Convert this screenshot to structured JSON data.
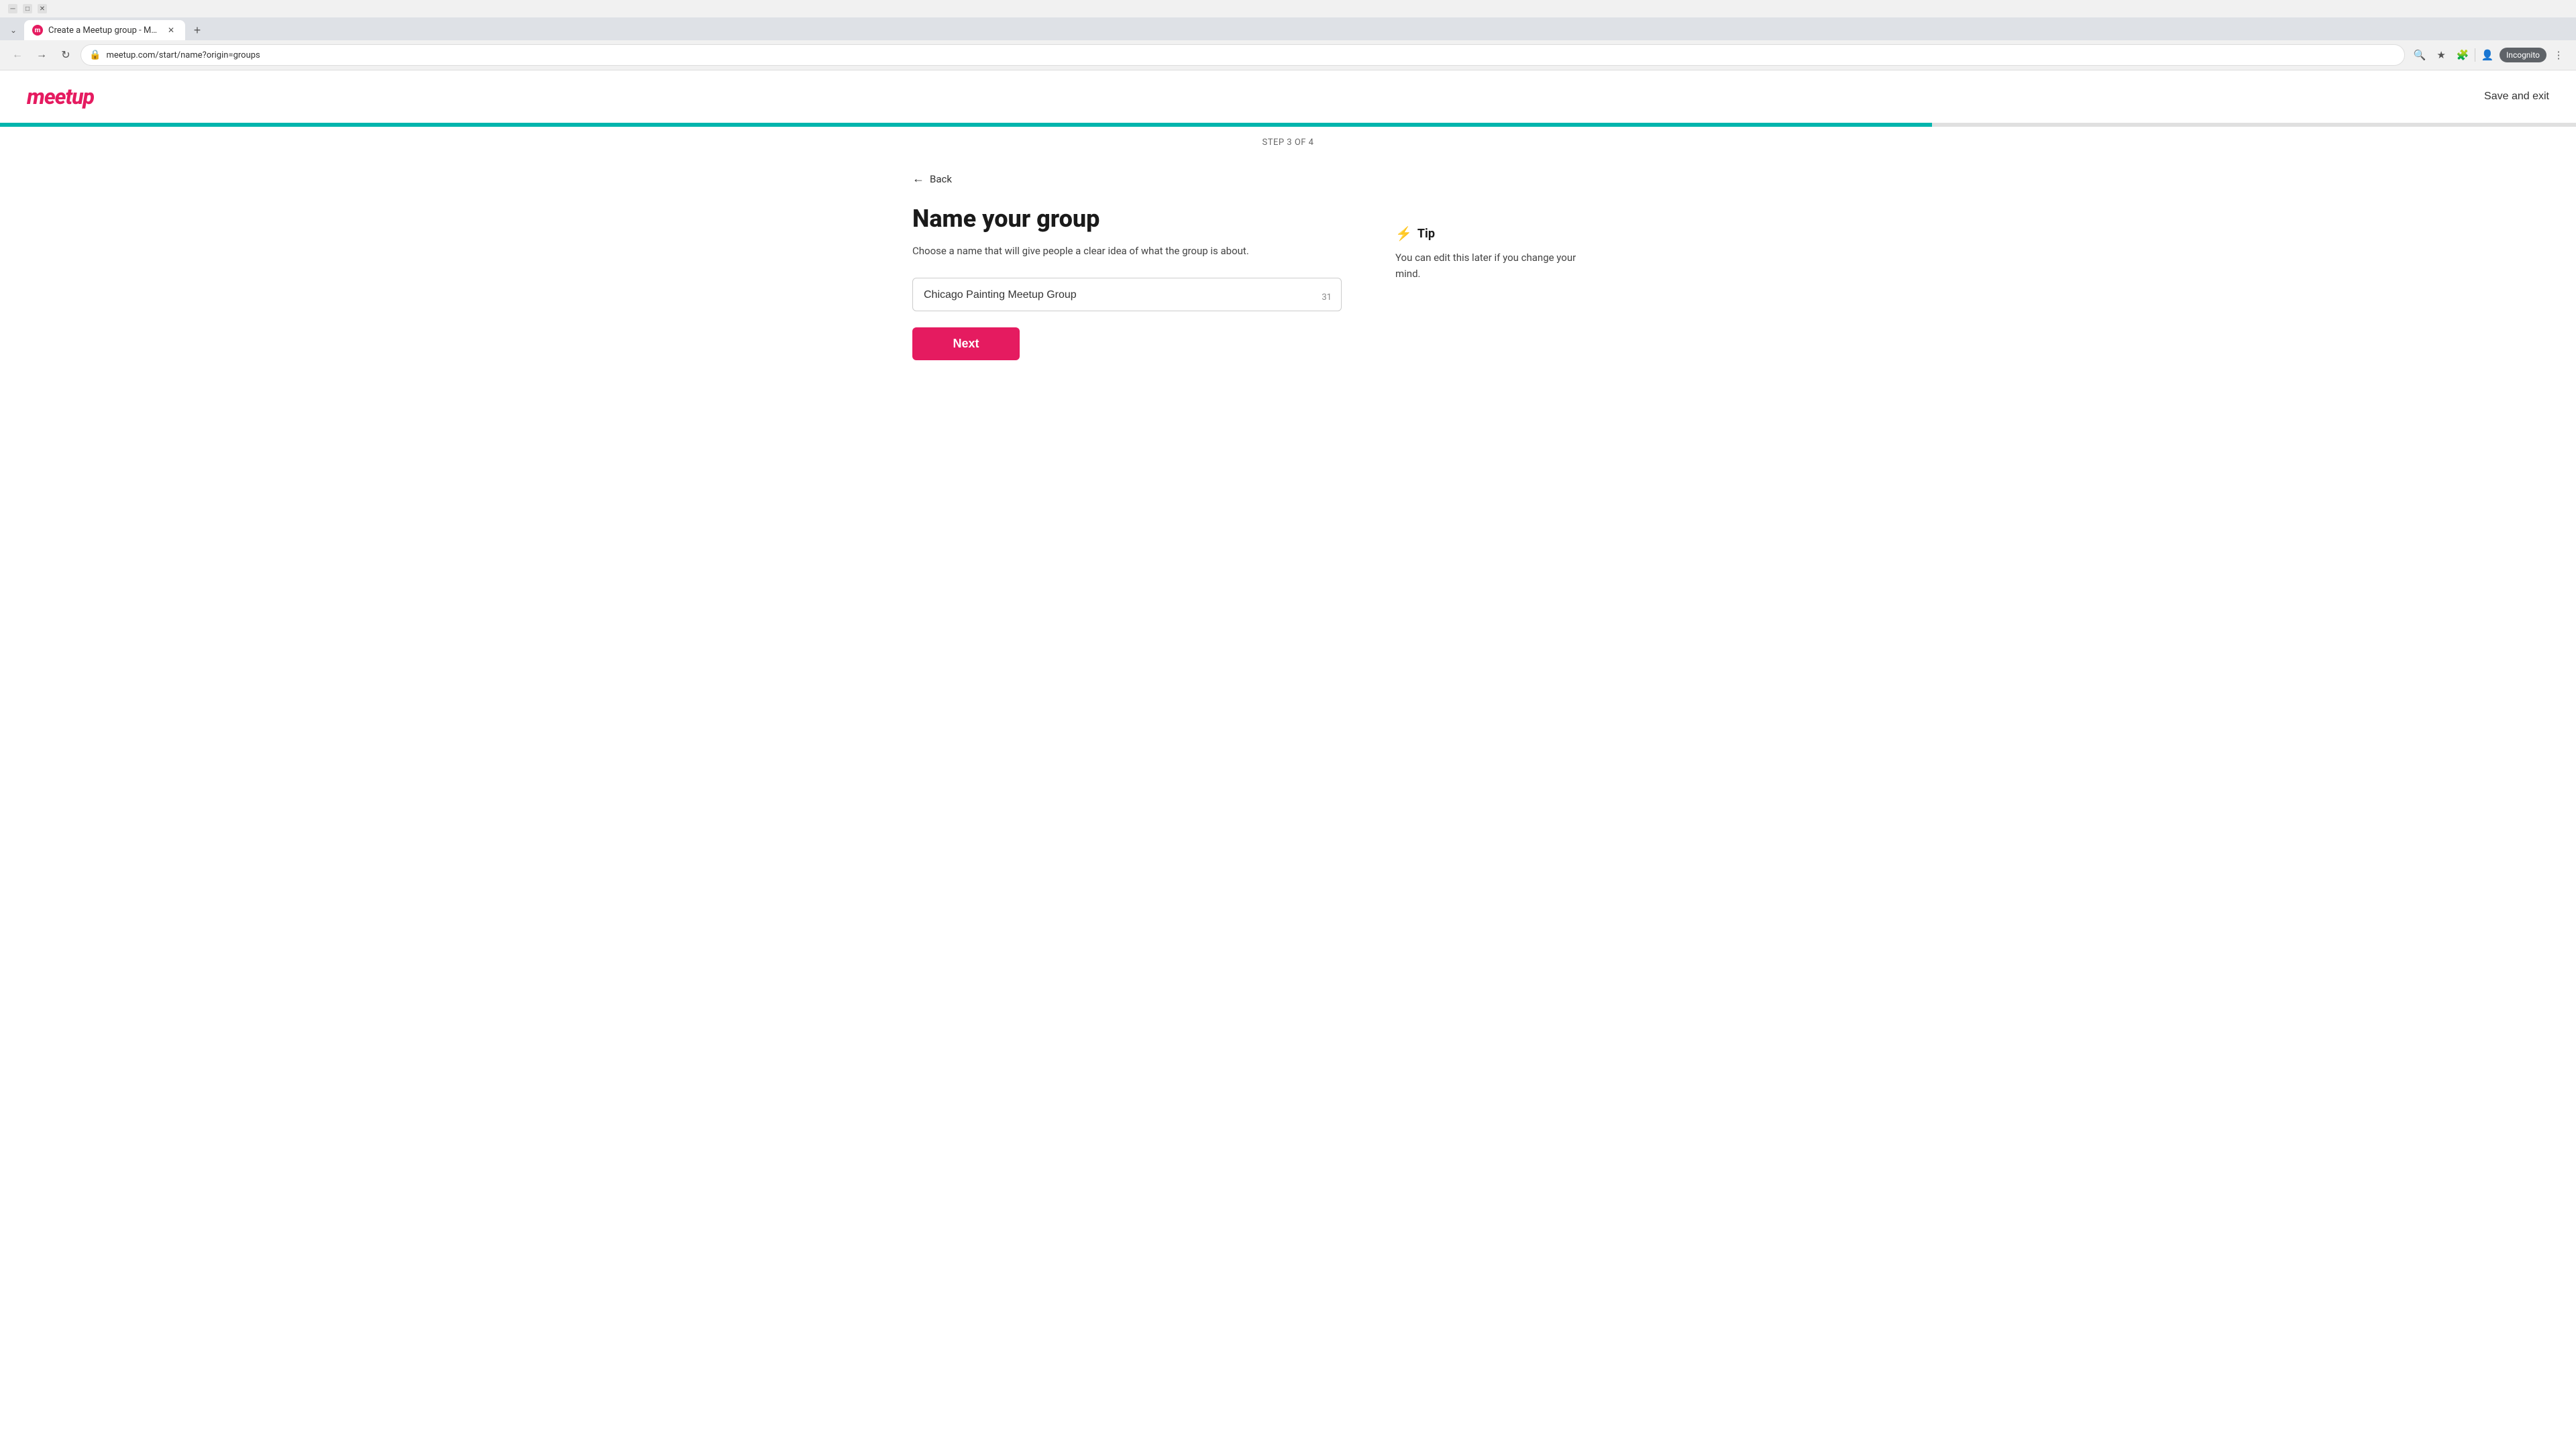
{
  "browser": {
    "tab_title": "Create a Meetup group - Meet...",
    "url": "meetup.com/start/name?origin=groups",
    "incognito_label": "Incognito",
    "new_tab_label": "+",
    "back_label": "←",
    "forward_label": "→",
    "reload_label": "↻"
  },
  "header": {
    "logo_text": "meetup",
    "save_exit_label": "Save and exit"
  },
  "progress": {
    "fill_percent": 75
  },
  "step_indicator": {
    "text": "STEP 3 OF 4"
  },
  "back_link": {
    "label": "Back"
  },
  "form": {
    "title": "Name your group",
    "subtitle": "Choose a name that will give people a clear idea of what the group is about.",
    "input_value": "Chicago Painting Meetup Group",
    "char_count": "31",
    "next_button_label": "Next"
  },
  "tip": {
    "icon": "⚡",
    "title": "Tip",
    "text": "You can edit this later if you change your mind."
  }
}
